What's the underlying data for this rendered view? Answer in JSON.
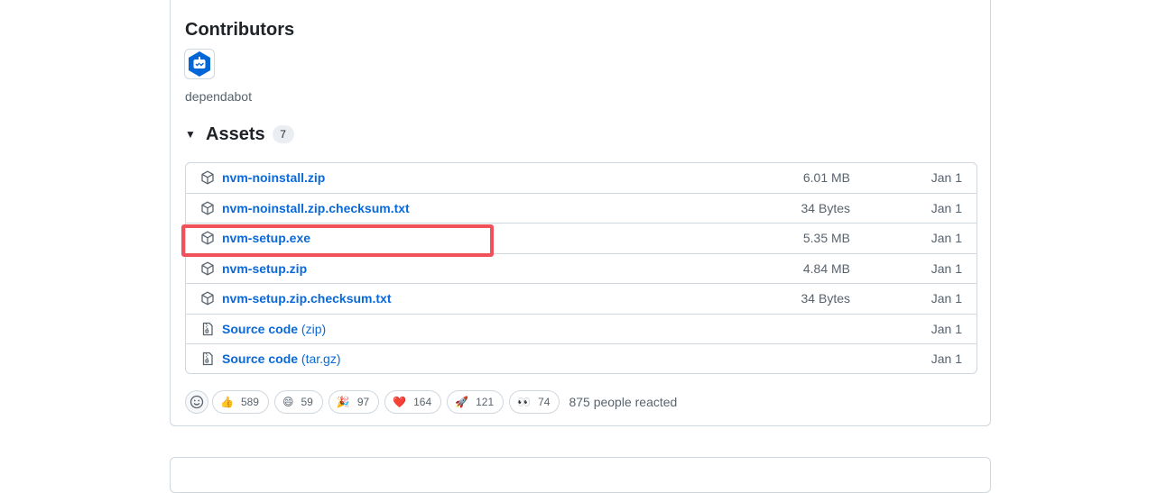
{
  "contributors": {
    "title": "Contributors",
    "items": [
      {
        "name": "dependabot",
        "avatar_icon": "dependabot-robot-icon"
      }
    ]
  },
  "assets": {
    "title": "Assets",
    "count": "7",
    "items": [
      {
        "name": "nvm-noinstall.zip",
        "suffix": "",
        "size": "6.01 MB",
        "date": "Jan 1",
        "icon": "package-icon"
      },
      {
        "name": "nvm-noinstall.zip.checksum.txt",
        "suffix": "",
        "size": "34 Bytes",
        "date": "Jan 1",
        "icon": "package-icon"
      },
      {
        "name": "nvm-setup.exe",
        "suffix": "",
        "size": "5.35 MB",
        "date": "Jan 1",
        "icon": "package-icon"
      },
      {
        "name": "nvm-setup.zip",
        "suffix": "",
        "size": "4.84 MB",
        "date": "Jan 1",
        "icon": "package-icon"
      },
      {
        "name": "nvm-setup.zip.checksum.txt",
        "suffix": "",
        "size": "34 Bytes",
        "date": "Jan 1",
        "icon": "package-icon"
      },
      {
        "name": "Source code",
        "suffix": "(zip)",
        "size": "",
        "date": "Jan 1",
        "icon": "file-zip-icon"
      },
      {
        "name": "Source code",
        "suffix": "(tar.gz)",
        "size": "",
        "date": "Jan 1",
        "icon": "file-zip-icon"
      }
    ]
  },
  "reactions": {
    "items": [
      {
        "emoji": "👍",
        "count": "589",
        "icon": "thumbs-up-emoji"
      },
      {
        "emoji": "😄",
        "count": "59",
        "icon": "laugh-emoji"
      },
      {
        "emoji": "🎉",
        "count": "97",
        "icon": "hooray-emoji"
      },
      {
        "emoji": "❤️",
        "count": "164",
        "icon": "heart-emoji"
      },
      {
        "emoji": "🚀",
        "count": "121",
        "icon": "rocket-emoji"
      },
      {
        "emoji": "👀",
        "count": "74",
        "icon": "eyes-emoji"
      }
    ],
    "summary": "875 people reacted"
  },
  "colors": {
    "link": "#0969da",
    "muted": "#59636e",
    "border": "#d0d7de",
    "highlight": "#f0515a",
    "dependabot_blue": "#0366d6"
  }
}
